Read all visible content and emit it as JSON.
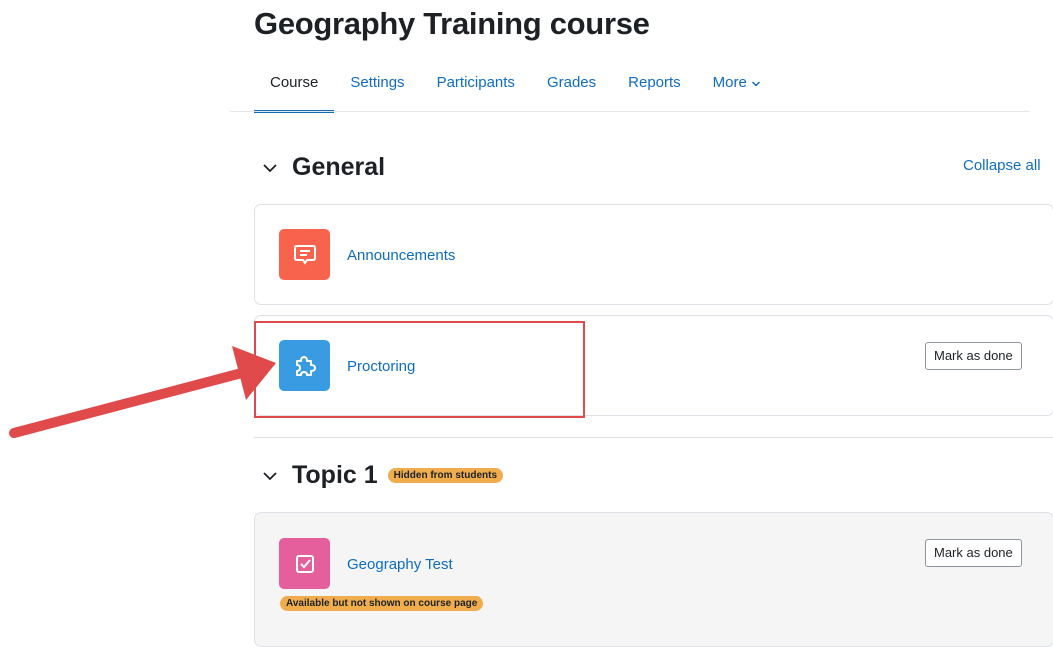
{
  "course": {
    "title": "Geography Training course"
  },
  "nav": {
    "tabs": [
      {
        "label": "Course",
        "active": true
      },
      {
        "label": "Settings"
      },
      {
        "label": "Participants"
      },
      {
        "label": "Grades"
      },
      {
        "label": "Reports"
      },
      {
        "label": "More"
      }
    ]
  },
  "sections": {
    "general": {
      "title": "General",
      "collapse_all": "Collapse all",
      "activities": [
        {
          "name": "Announcements",
          "icon": "forum-icon",
          "color": "#f7634d"
        },
        {
          "name": "Proctoring",
          "icon": "plugin-puzzle-icon",
          "color": "#399be2",
          "button": "Mark as done"
        }
      ]
    },
    "topic1": {
      "title": "Topic 1",
      "badge": "Hidden from students",
      "activities": [
        {
          "name": "Geography Test",
          "icon": "quiz-icon",
          "color": "#e55f9d",
          "button": "Mark as done",
          "badge": "Available but not shown on course page"
        }
      ]
    }
  },
  "colors": {
    "link": "#0f6cbf",
    "badge": "#f0ad4e",
    "annotation": "#e04a4a"
  }
}
